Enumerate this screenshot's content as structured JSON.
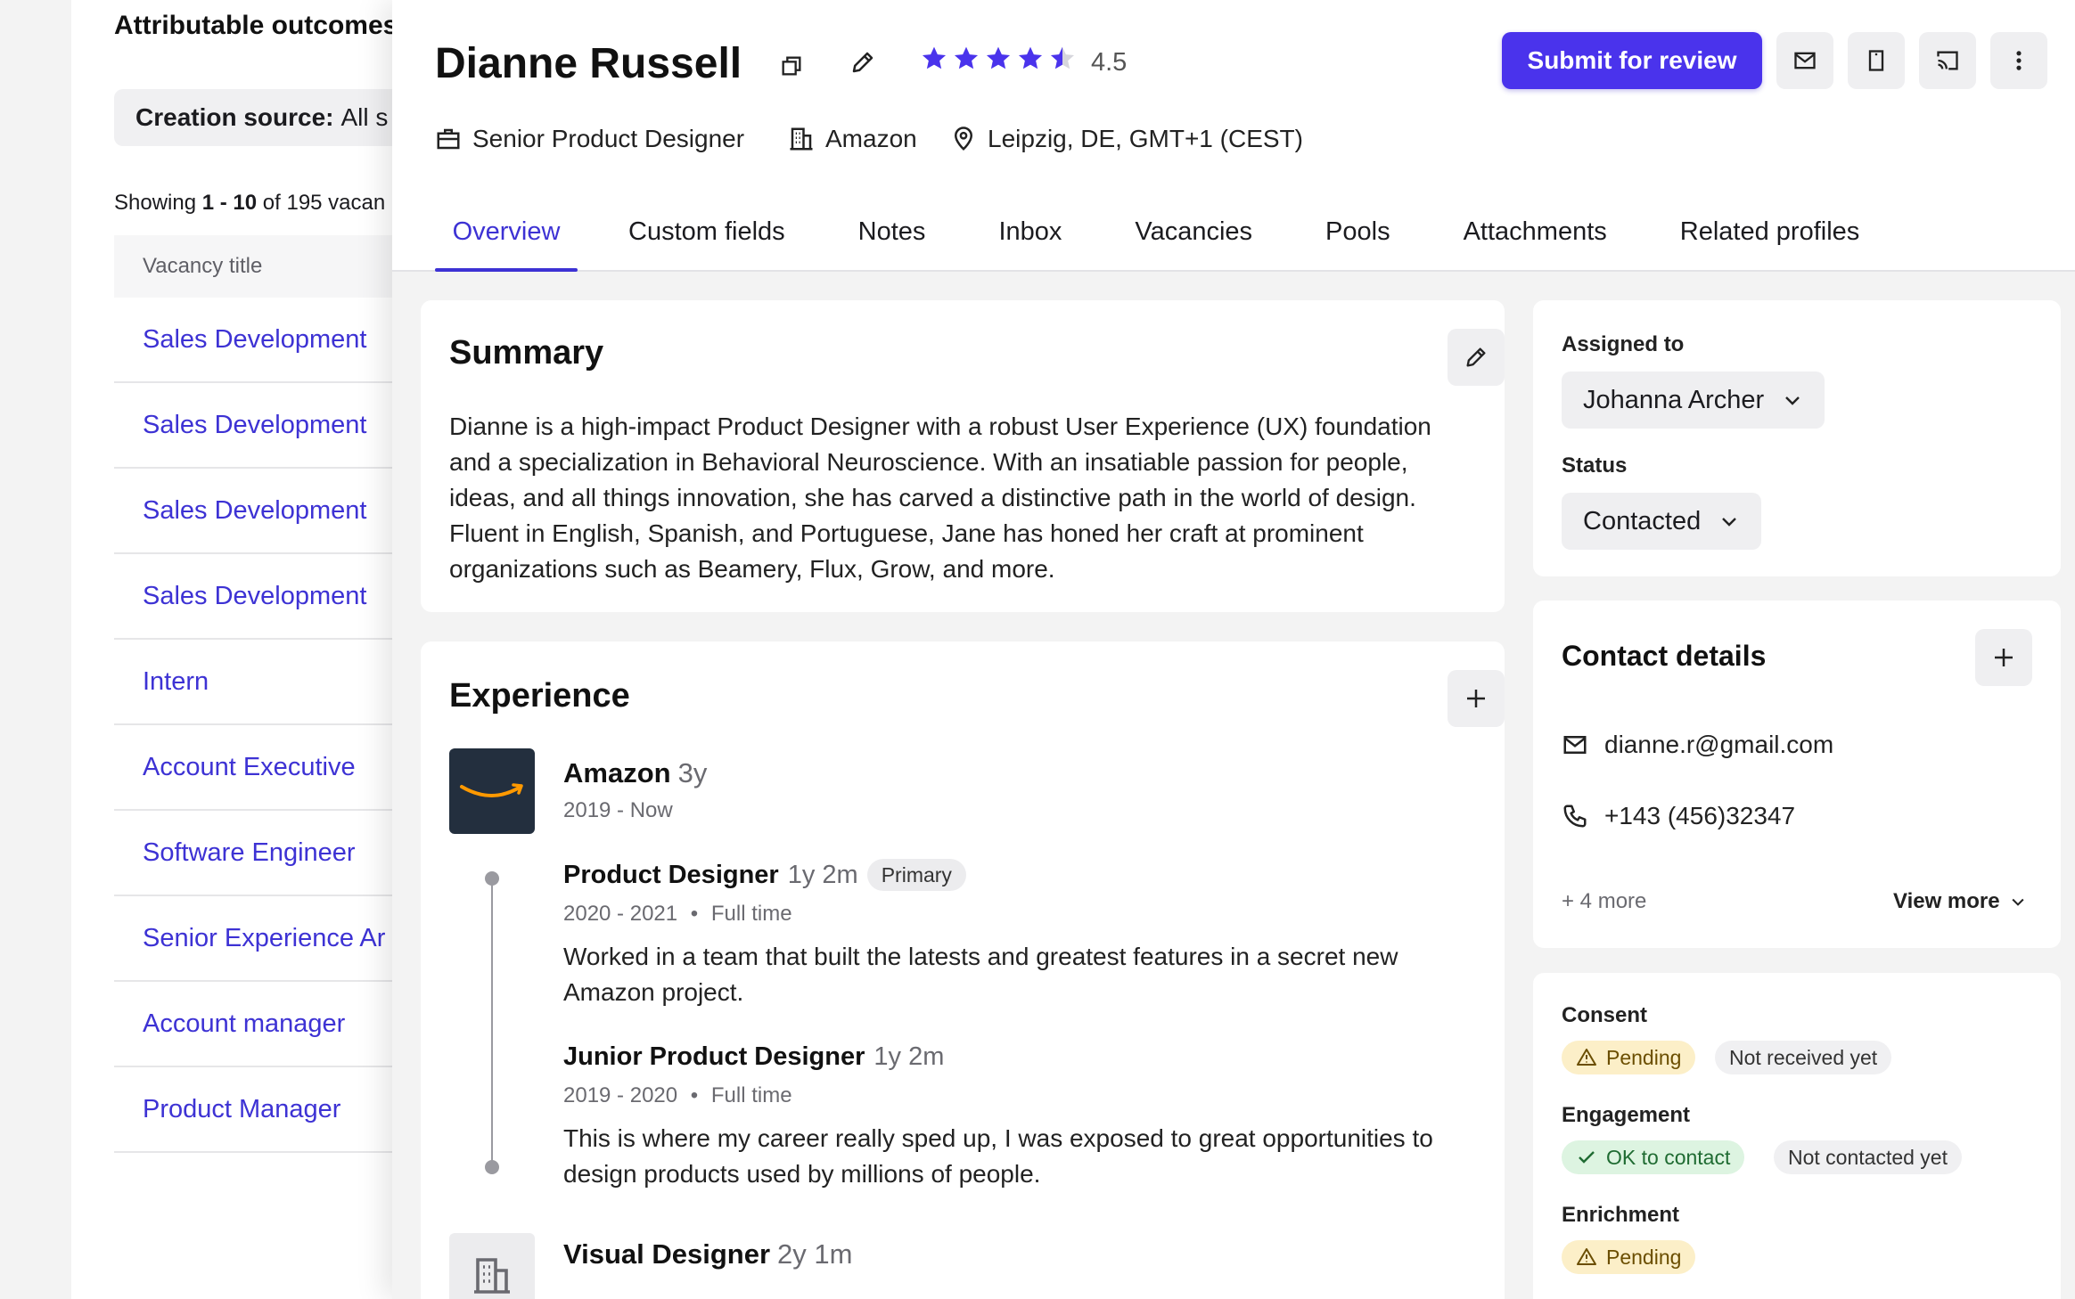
{
  "background": {
    "title": "Attributable outcomes",
    "filter": {
      "label": "Creation source:",
      "value": "All s"
    },
    "showing": {
      "prefix": "Showing",
      "range": "1 - 10",
      "middle": "of 195 vacan"
    },
    "table_header": "Vacancy title",
    "rows": [
      "Sales Development",
      "Sales Development",
      "Sales Development",
      "Sales Development",
      "Intern",
      "Account Executive",
      "Software Engineer",
      "Senior Experience Ar",
      "Account manager",
      "Product Manager"
    ]
  },
  "profile": {
    "name": "Dianne Russell",
    "rating": {
      "value": "4.5",
      "stars": 4.5,
      "max": 5
    },
    "job_title": "Senior Product Designer",
    "company": "Amazon",
    "location": "Leipzig, DE, GMT+1 (CEST)",
    "submit_label": "Submit for review"
  },
  "tabs": [
    "Overview",
    "Custom fields",
    "Notes",
    "Inbox",
    "Vacancies",
    "Pools",
    "Attachments",
    "Related profiles"
  ],
  "summary": {
    "title": "Summary",
    "text": "Dianne is a high-impact Product Designer with a robust User Experience (UX) foundation and a specialization in Behavioral Neuroscience. With an insatiable passion for people, ideas, and all things innovation, she has carved a distinctive path in the world of design. Fluent in English, Spanish, and Portuguese, Jane has honed her craft at prominent organizations such as Beamery, Flux, Grow, and more."
  },
  "experience": {
    "title": "Experience",
    "company": {
      "name": "Amazon",
      "duration": "3y",
      "dates": "2019 - Now"
    },
    "roles": [
      {
        "title": "Product Designer",
        "duration": "1y 2m",
        "badge": "Primary",
        "dates": "2020 - 2021",
        "type": "Full time",
        "description": "Worked in a team that built the latests and greatest features in a secret new Amazon project."
      },
      {
        "title": "Junior Product Designer",
        "duration": "1y 2m",
        "dates": "2019 - 2020",
        "type": "Full time",
        "description": "This is where my career really sped up, I was exposed to great opportunities to design products used by millions of people."
      }
    ],
    "next": {
      "title": "Visual Designer",
      "duration": "2y 1m"
    }
  },
  "assignment": {
    "assigned_label": "Assigned to",
    "assigned_value": "Johanna Archer",
    "status_label": "Status",
    "status_value": "Contacted"
  },
  "contact": {
    "title": "Contact details",
    "email": "dianne.r@gmail.com",
    "phone": "+143 (456)32347",
    "more": "+ 4 more",
    "view_more": "View more"
  },
  "flags": {
    "consent": {
      "label": "Consent",
      "status": "Pending",
      "note": "Not received yet"
    },
    "engagement": {
      "label": "Engagement",
      "status": "OK to contact",
      "note": "Not contacted yet"
    },
    "enrichment": {
      "label": "Enrichment",
      "status": "Pending"
    }
  },
  "colors": {
    "accent": "#4a33ec",
    "link": "#3d32d4",
    "star": "#4a33ec",
    "warn_bg": "#fcefc8",
    "ok_bg": "#ddf4e1"
  }
}
